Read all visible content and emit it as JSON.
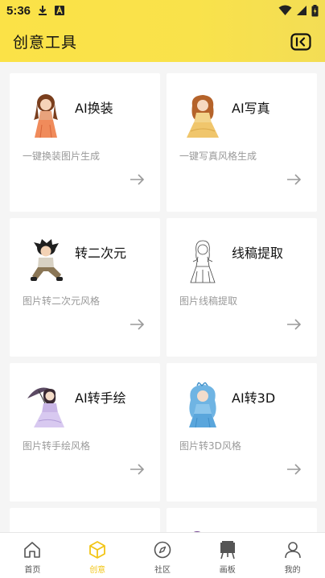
{
  "status_bar": {
    "time": "5:36"
  },
  "header": {
    "title": "创意工具"
  },
  "cards": [
    {
      "title": "AI换装",
      "desc": "一键换装图片生成",
      "icon": "fashion-girl-illustration"
    },
    {
      "title": "AI写真",
      "desc": "一键写真风格生成",
      "icon": "portrait-girl-illustration"
    },
    {
      "title": "转二次元",
      "desc": "图片转二次元风格",
      "icon": "anime-boy-illustration"
    },
    {
      "title": "线稿提取",
      "desc": "图片线稿提取",
      "icon": "line-art-girl-illustration"
    },
    {
      "title": "AI转手绘",
      "desc": "图片转手绘风格",
      "icon": "parasol-girl-illustration"
    },
    {
      "title": "AI转3D",
      "desc": "图片转3D风格",
      "icon": "blue-hair-girl-illustration"
    }
  ],
  "tabs": [
    {
      "label": "首页",
      "icon": "home-icon",
      "active": false
    },
    {
      "label": "创意",
      "icon": "cube-icon",
      "active": true
    },
    {
      "label": "社区",
      "icon": "compass-icon",
      "active": false
    },
    {
      "label": "画板",
      "icon": "easel-icon",
      "active": false
    },
    {
      "label": "我的",
      "icon": "person-icon",
      "active": false
    }
  ],
  "colors": {
    "header_yellow": "#fbe247",
    "accent": "#f2c516",
    "muted_text": "#9a9a9a"
  }
}
